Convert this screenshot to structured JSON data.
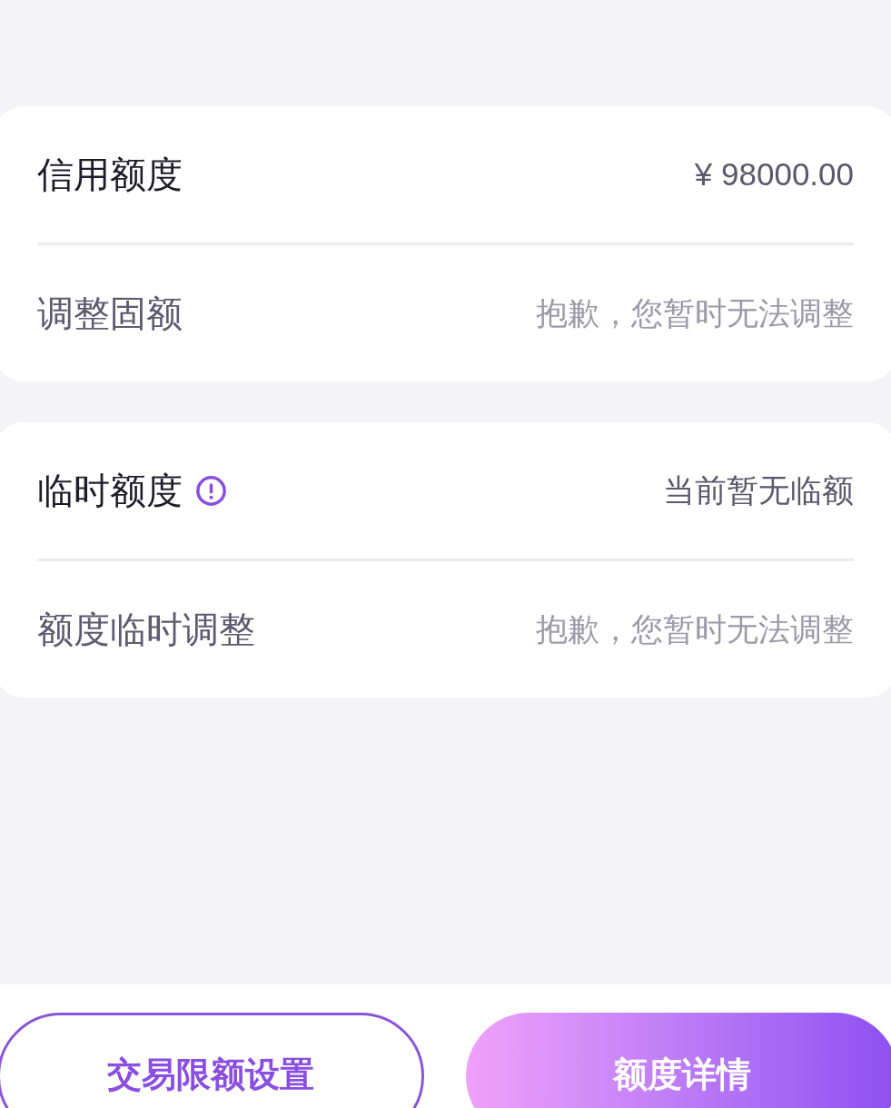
{
  "sections": [
    {
      "rows": [
        {
          "kind": "primary",
          "label": "信用额度",
          "info": false,
          "value": "¥ 98000.00"
        },
        {
          "kind": "secondary",
          "label": "调整固额",
          "info": false,
          "value": "抱歉，您暂时无法调整"
        }
      ]
    },
    {
      "rows": [
        {
          "kind": "primary",
          "label": "临时额度",
          "info": true,
          "value": "当前暂无临额"
        },
        {
          "kind": "secondary",
          "label": "额度临时调整",
          "info": false,
          "value": "抱歉，您暂时无法调整"
        }
      ]
    }
  ],
  "buttons": [
    {
      "kind": "outline",
      "label": "交易限额设置"
    },
    {
      "kind": "filled",
      "label": "额度详情"
    }
  ]
}
